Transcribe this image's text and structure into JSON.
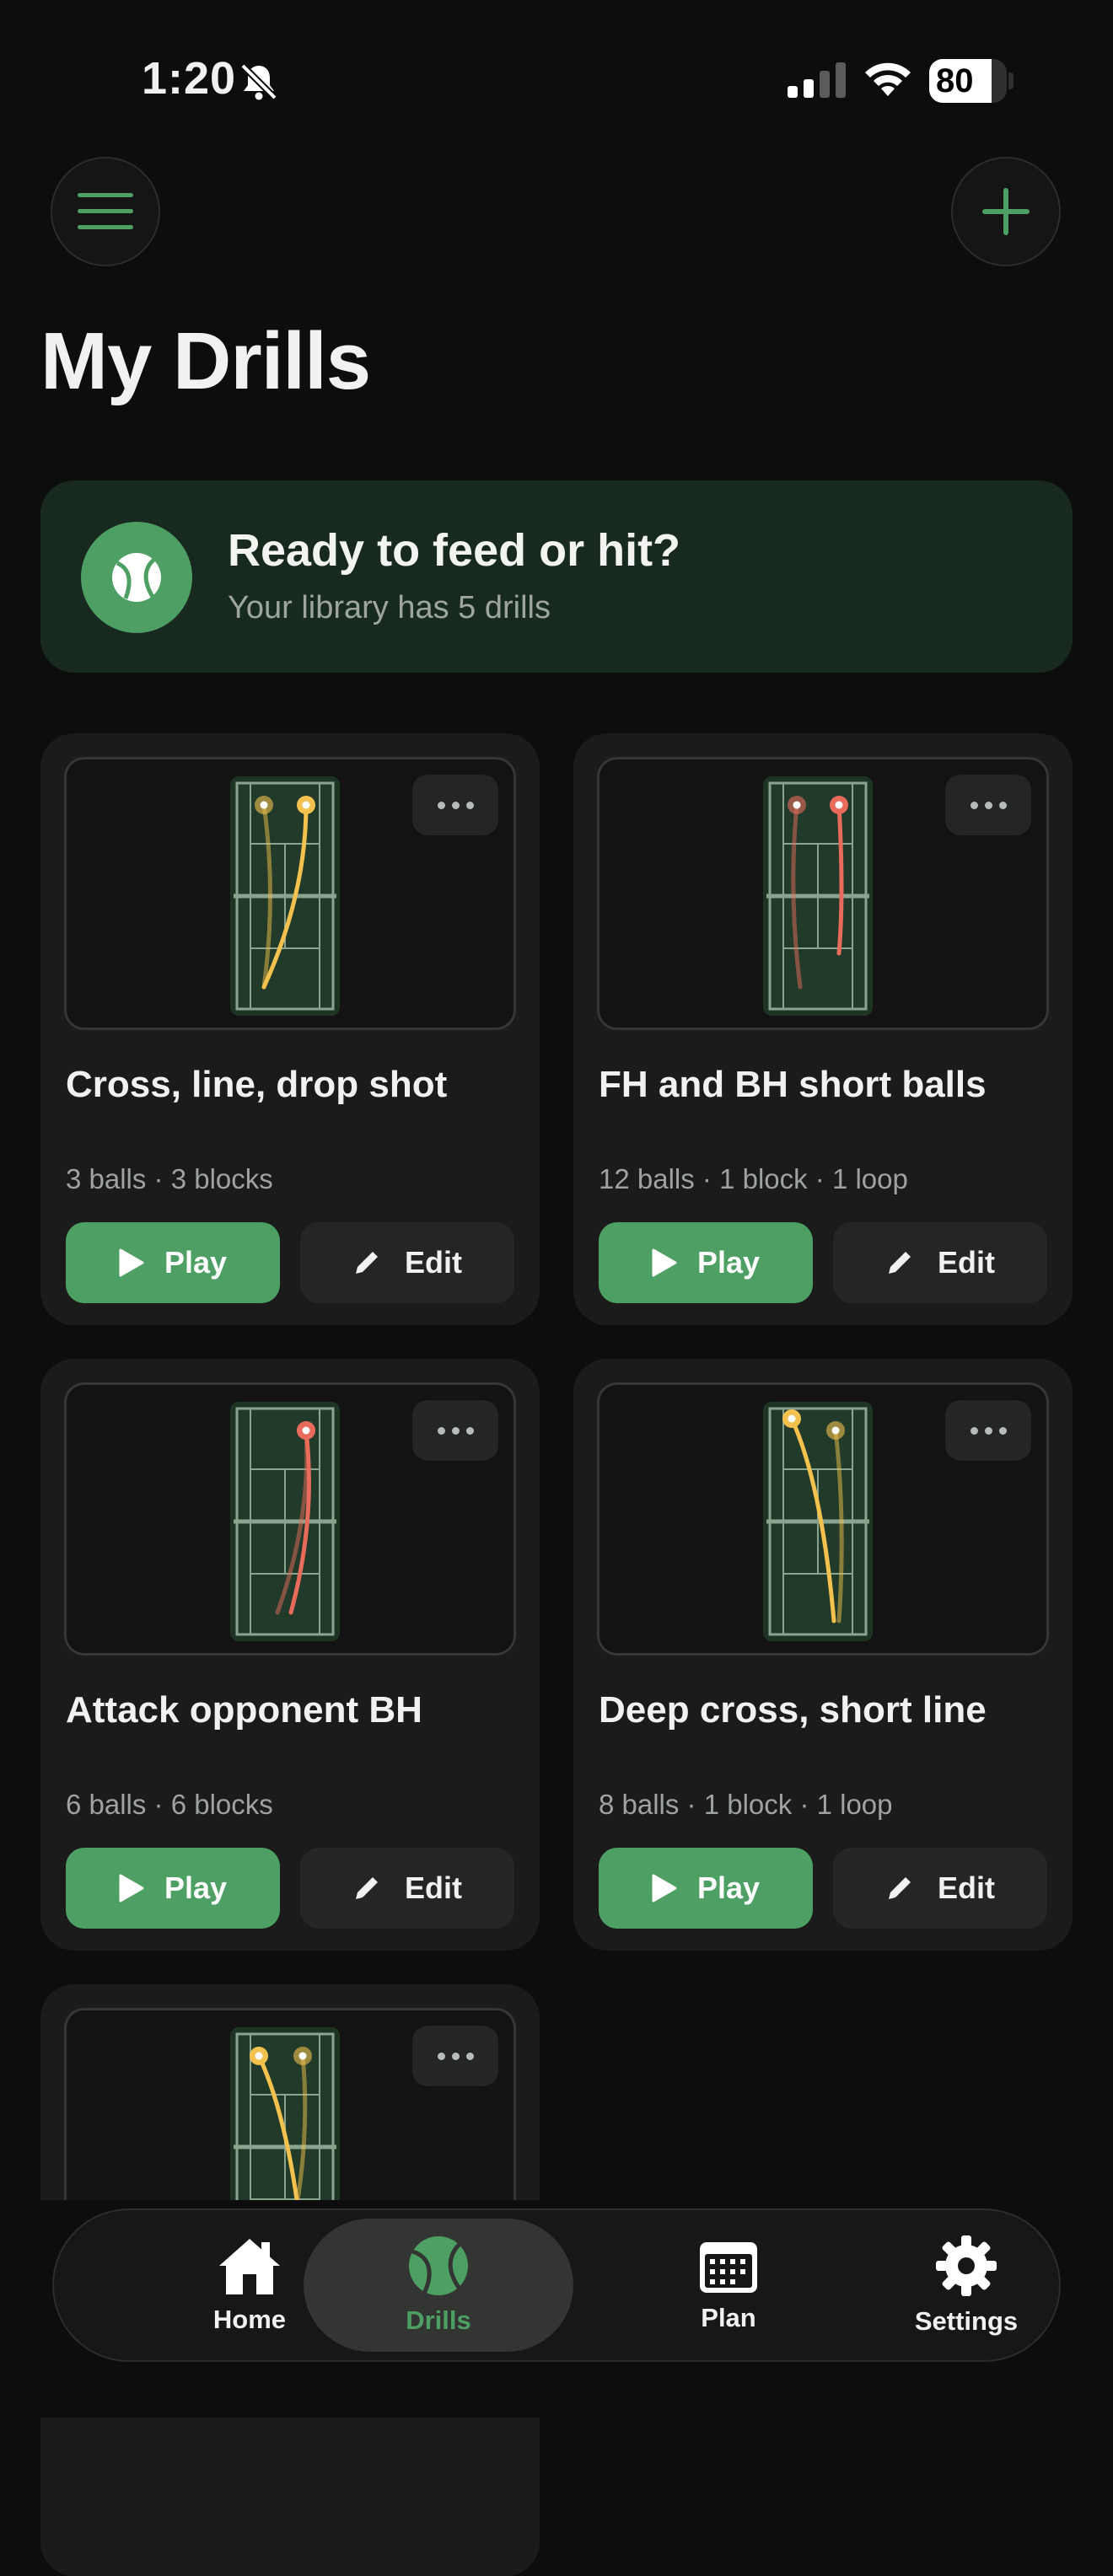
{
  "status_bar": {
    "time": "1:20",
    "battery": "80",
    "battery_level": 0.8
  },
  "header": {
    "title": "My Drills"
  },
  "banner": {
    "title": "Ready to feed or hit?",
    "subtitle": "Your library has 5 drills"
  },
  "drills": [
    {
      "title": "Cross, line, drop shot",
      "meta": "3 balls · 3 blocks",
      "play_label": "Play",
      "edit_label": "Edit",
      "color": "#f2c14e"
    },
    {
      "title": "FH and BH short balls",
      "meta": "12 balls · 1 block · 1 loop",
      "play_label": "Play",
      "edit_label": "Edit",
      "color": "#e86b5c"
    },
    {
      "title": "Attack opponent BH",
      "meta": "6 balls · 6 blocks",
      "play_label": "Play",
      "edit_label": "Edit",
      "color": "#e86b5c"
    },
    {
      "title": "Deep cross, short line",
      "meta": "8 balls · 1 block · 1 loop",
      "play_label": "Play",
      "edit_label": "Edit",
      "color": "#f2c14e"
    },
    {
      "title": "",
      "meta": "",
      "color": "#f2c14e"
    }
  ],
  "tabs": [
    {
      "label": "Home",
      "icon": "home-icon"
    },
    {
      "label": "Drills",
      "icon": "tennis-ball-icon",
      "active": true
    },
    {
      "label": "Plan",
      "icon": "calendar-icon"
    },
    {
      "label": "Settings",
      "icon": "gear-icon"
    }
  ],
  "colors": {
    "accent": "#4e9f63",
    "background": "#0c0d0c",
    "card": "#1a1b1a",
    "banner": "#182a1f"
  }
}
